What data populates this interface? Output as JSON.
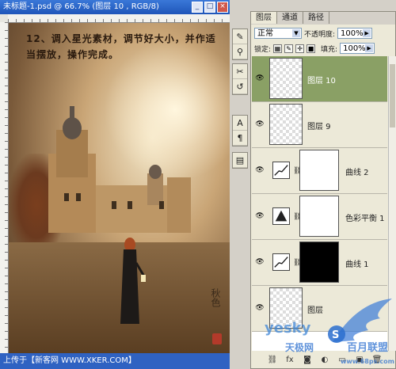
{
  "document": {
    "title": "未标题-1.psd @ 66.7% (图层 10 , RGB/8)",
    "caption": "12、调入星光素材，调节好大小，并作适当摆放，操作完成。",
    "status_text": "上传于【新客网 WWW.XKER.COM】"
  },
  "tools": [
    {
      "icon": "brush-icon",
      "glyph": "✎"
    },
    {
      "icon": "stamp-icon",
      "glyph": "⚲"
    },
    {
      "icon": "text-icon",
      "glyph": "A"
    },
    {
      "icon": "paragraph-icon",
      "glyph": "¶"
    },
    {
      "icon": "tools-icon",
      "glyph": "✂"
    },
    {
      "icon": "history-icon",
      "glyph": "↺"
    }
  ],
  "layers_panel": {
    "tabs": [
      "图层",
      "通道",
      "路径"
    ],
    "blend_mode": "正常",
    "opacity_label": "不透明度:",
    "opacity_value": "100%",
    "lock_label": "锁定:",
    "fill_label": "填充:",
    "fill_value": "100%",
    "layers": [
      {
        "name": "图层 10",
        "kind": "pixel",
        "selected": true
      },
      {
        "name": "图层 9",
        "kind": "pixel",
        "selected": false
      },
      {
        "name": "曲线 2",
        "kind": "curves",
        "mask": "white",
        "selected": false
      },
      {
        "name": "色彩平衡 1",
        "kind": "color-balance",
        "mask": "white",
        "selected": false
      },
      {
        "name": "曲线 1",
        "kind": "curves",
        "mask": "black",
        "selected": false
      },
      {
        "name": "图层",
        "kind": "pixel",
        "selected": false
      }
    ]
  },
  "watermark": {
    "site_text": "yesky",
    "cn_text": "天极网",
    "brand_text": "百月联盟",
    "url_text": "www.68ps.com"
  },
  "colors": {
    "titlebar": "#2f62c2",
    "selected_layer": "#8aa065"
  }
}
